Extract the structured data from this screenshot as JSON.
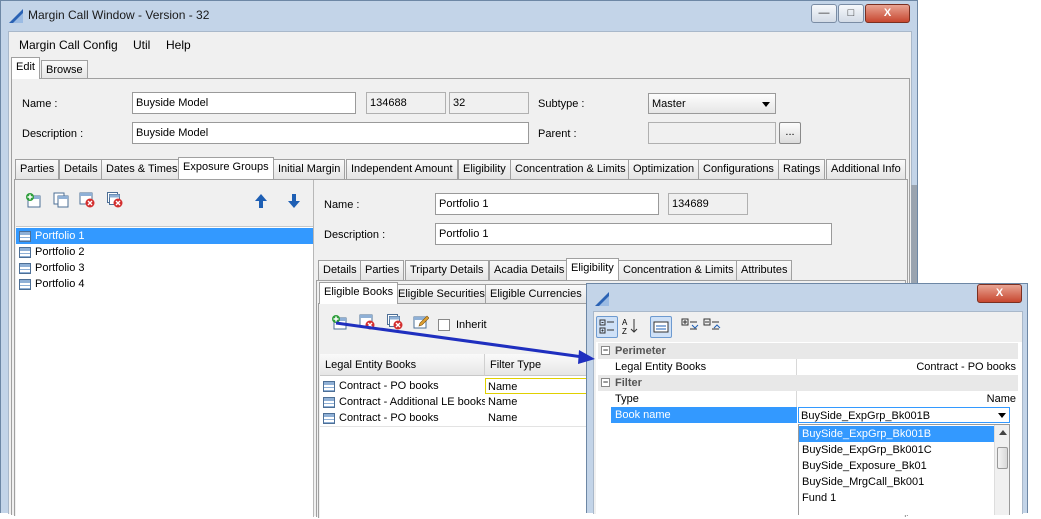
{
  "window": {
    "title": "Margin Call Window - Version - 32",
    "minimize": "—",
    "maximize": "□",
    "close": "X"
  },
  "menu": [
    "Margin Call Config",
    "Util",
    "Help"
  ],
  "mode_tabs": [
    "Edit",
    "Browse"
  ],
  "header": {
    "name_label": "Name :",
    "name_value": "Buyside Model",
    "id_value": "134688",
    "version_value": "32",
    "subtype_label": "Subtype :",
    "subtype_value": "Master",
    "description_label": "Description :",
    "description_value": "Buyside  Model",
    "parent_label": "Parent :",
    "parent_value": "",
    "browse_button": "..."
  },
  "main_tabs": [
    "Parties",
    "Details",
    "Dates & Times",
    "Exposure Groups",
    "Initial Margin",
    "Independent Amount",
    "Eligibility",
    "Concentration & Limits",
    "Optimization",
    "Configurations",
    "Ratings",
    "Additional Info"
  ],
  "left_toolbar_icons": [
    "add-icon",
    "copy-icon",
    "delete-icon",
    "delete-all-icon",
    "move-up-icon",
    "move-down-icon"
  ],
  "portfolios": [
    "Portfolio 1",
    "Portfolio 2",
    "Portfolio 3",
    "Portfolio 4"
  ],
  "detail": {
    "name_label": "Name :",
    "name_value": "Portfolio 1",
    "id_value": "134689",
    "description_label": "Description :",
    "description_value": "Portfolio 1"
  },
  "sub_tabs": [
    "Details",
    "Parties",
    "Triparty Details",
    "Acadia Details",
    "Eligibility",
    "Concentration & Limits",
    "Attributes"
  ],
  "eligibility_tabs": [
    "Eligible Books",
    "Eligible Securities",
    "Eligible Currencies"
  ],
  "inherit_label": "Inherit",
  "books_grid": {
    "headers": [
      "Legal Entity Books",
      "Filter Type"
    ],
    "rows": [
      {
        "book": "Contract - PO books",
        "filter": "Name"
      },
      {
        "book": "Contract - Additional LE books",
        "filter": "Name"
      },
      {
        "book": "Contract - PO books",
        "filter": "Name"
      }
    ]
  },
  "popup": {
    "close": "X",
    "sections": [
      {
        "title": "Perimeter",
        "rows": [
          {
            "label": "Legal Entity Books",
            "value": "Contract - PO books"
          }
        ]
      },
      {
        "title": "Filter",
        "rows": [
          {
            "label": "Type",
            "value": "Name"
          },
          {
            "label": "Book name",
            "value": "BuySide_ExpGrp_Bk001B"
          }
        ]
      }
    ],
    "dropdown_options": [
      "BuySide_ExpGrp_Bk001B",
      "BuySide_ExpGrp_Bk001C",
      "BuySide_Exposure_Bk01",
      "BuySide_MrgCall_Bk001",
      "Fund 1"
    ]
  },
  "colors": {
    "selection": "#3399ff",
    "window_frame": "#c3d4e8",
    "arrow": "#1f2fbf"
  }
}
